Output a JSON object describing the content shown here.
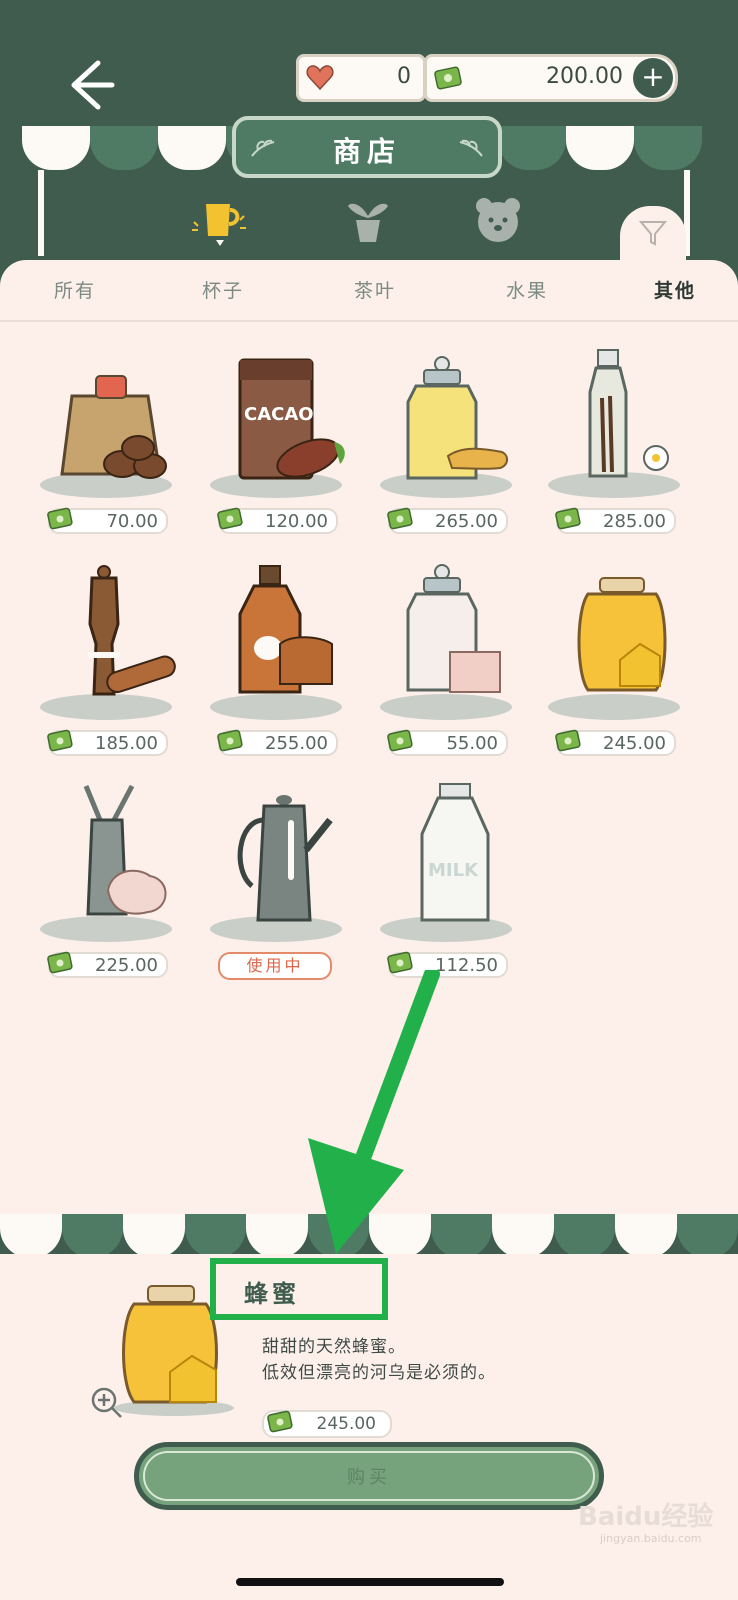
{
  "header": {
    "back_label": "",
    "hearts": "0",
    "money": "200.00",
    "add_label": "+",
    "title": "商店"
  },
  "categories": [
    "cup-icon",
    "plant-icon",
    "bear-icon",
    "filter-icon"
  ],
  "tabs": [
    {
      "label": "所有"
    },
    {
      "label": "杯子"
    },
    {
      "label": "茶叶"
    },
    {
      "label": "水果"
    },
    {
      "label": "其他",
      "active": true
    }
  ],
  "items": [
    {
      "name": "coffee-bag",
      "price": "70.00"
    },
    {
      "name": "cacao",
      "price": "120.00"
    },
    {
      "name": "ginger-jar",
      "price": "265.00"
    },
    {
      "name": "vanilla-bottle",
      "price": "285.00"
    },
    {
      "name": "cinnamon-grinder",
      "price": "185.00"
    },
    {
      "name": "maple-syrup",
      "price": "255.00"
    },
    {
      "name": "sugar-cubes",
      "price": "55.00"
    },
    {
      "name": "honey-jar",
      "price": "245.00"
    },
    {
      "name": "cream-whipper",
      "price": "225.00"
    },
    {
      "name": "kettle",
      "status": "使用中"
    },
    {
      "name": "milk-bottle",
      "price": "112.50"
    }
  ],
  "detail": {
    "title": "蜂蜜",
    "desc_line1": "甜甜的天然蜂蜜。",
    "desc_line2": "低效但漂亮的河乌是必须的。",
    "price": "245.00",
    "buy_label": "购买"
  },
  "watermark": {
    "main": "Baidu经验",
    "sub": "jingyan.baidu.com"
  },
  "colors": {
    "primary": "#3f5c4e",
    "panel": "#fdf0ea",
    "accent": "#22b04a",
    "money": "#7bb64a"
  }
}
